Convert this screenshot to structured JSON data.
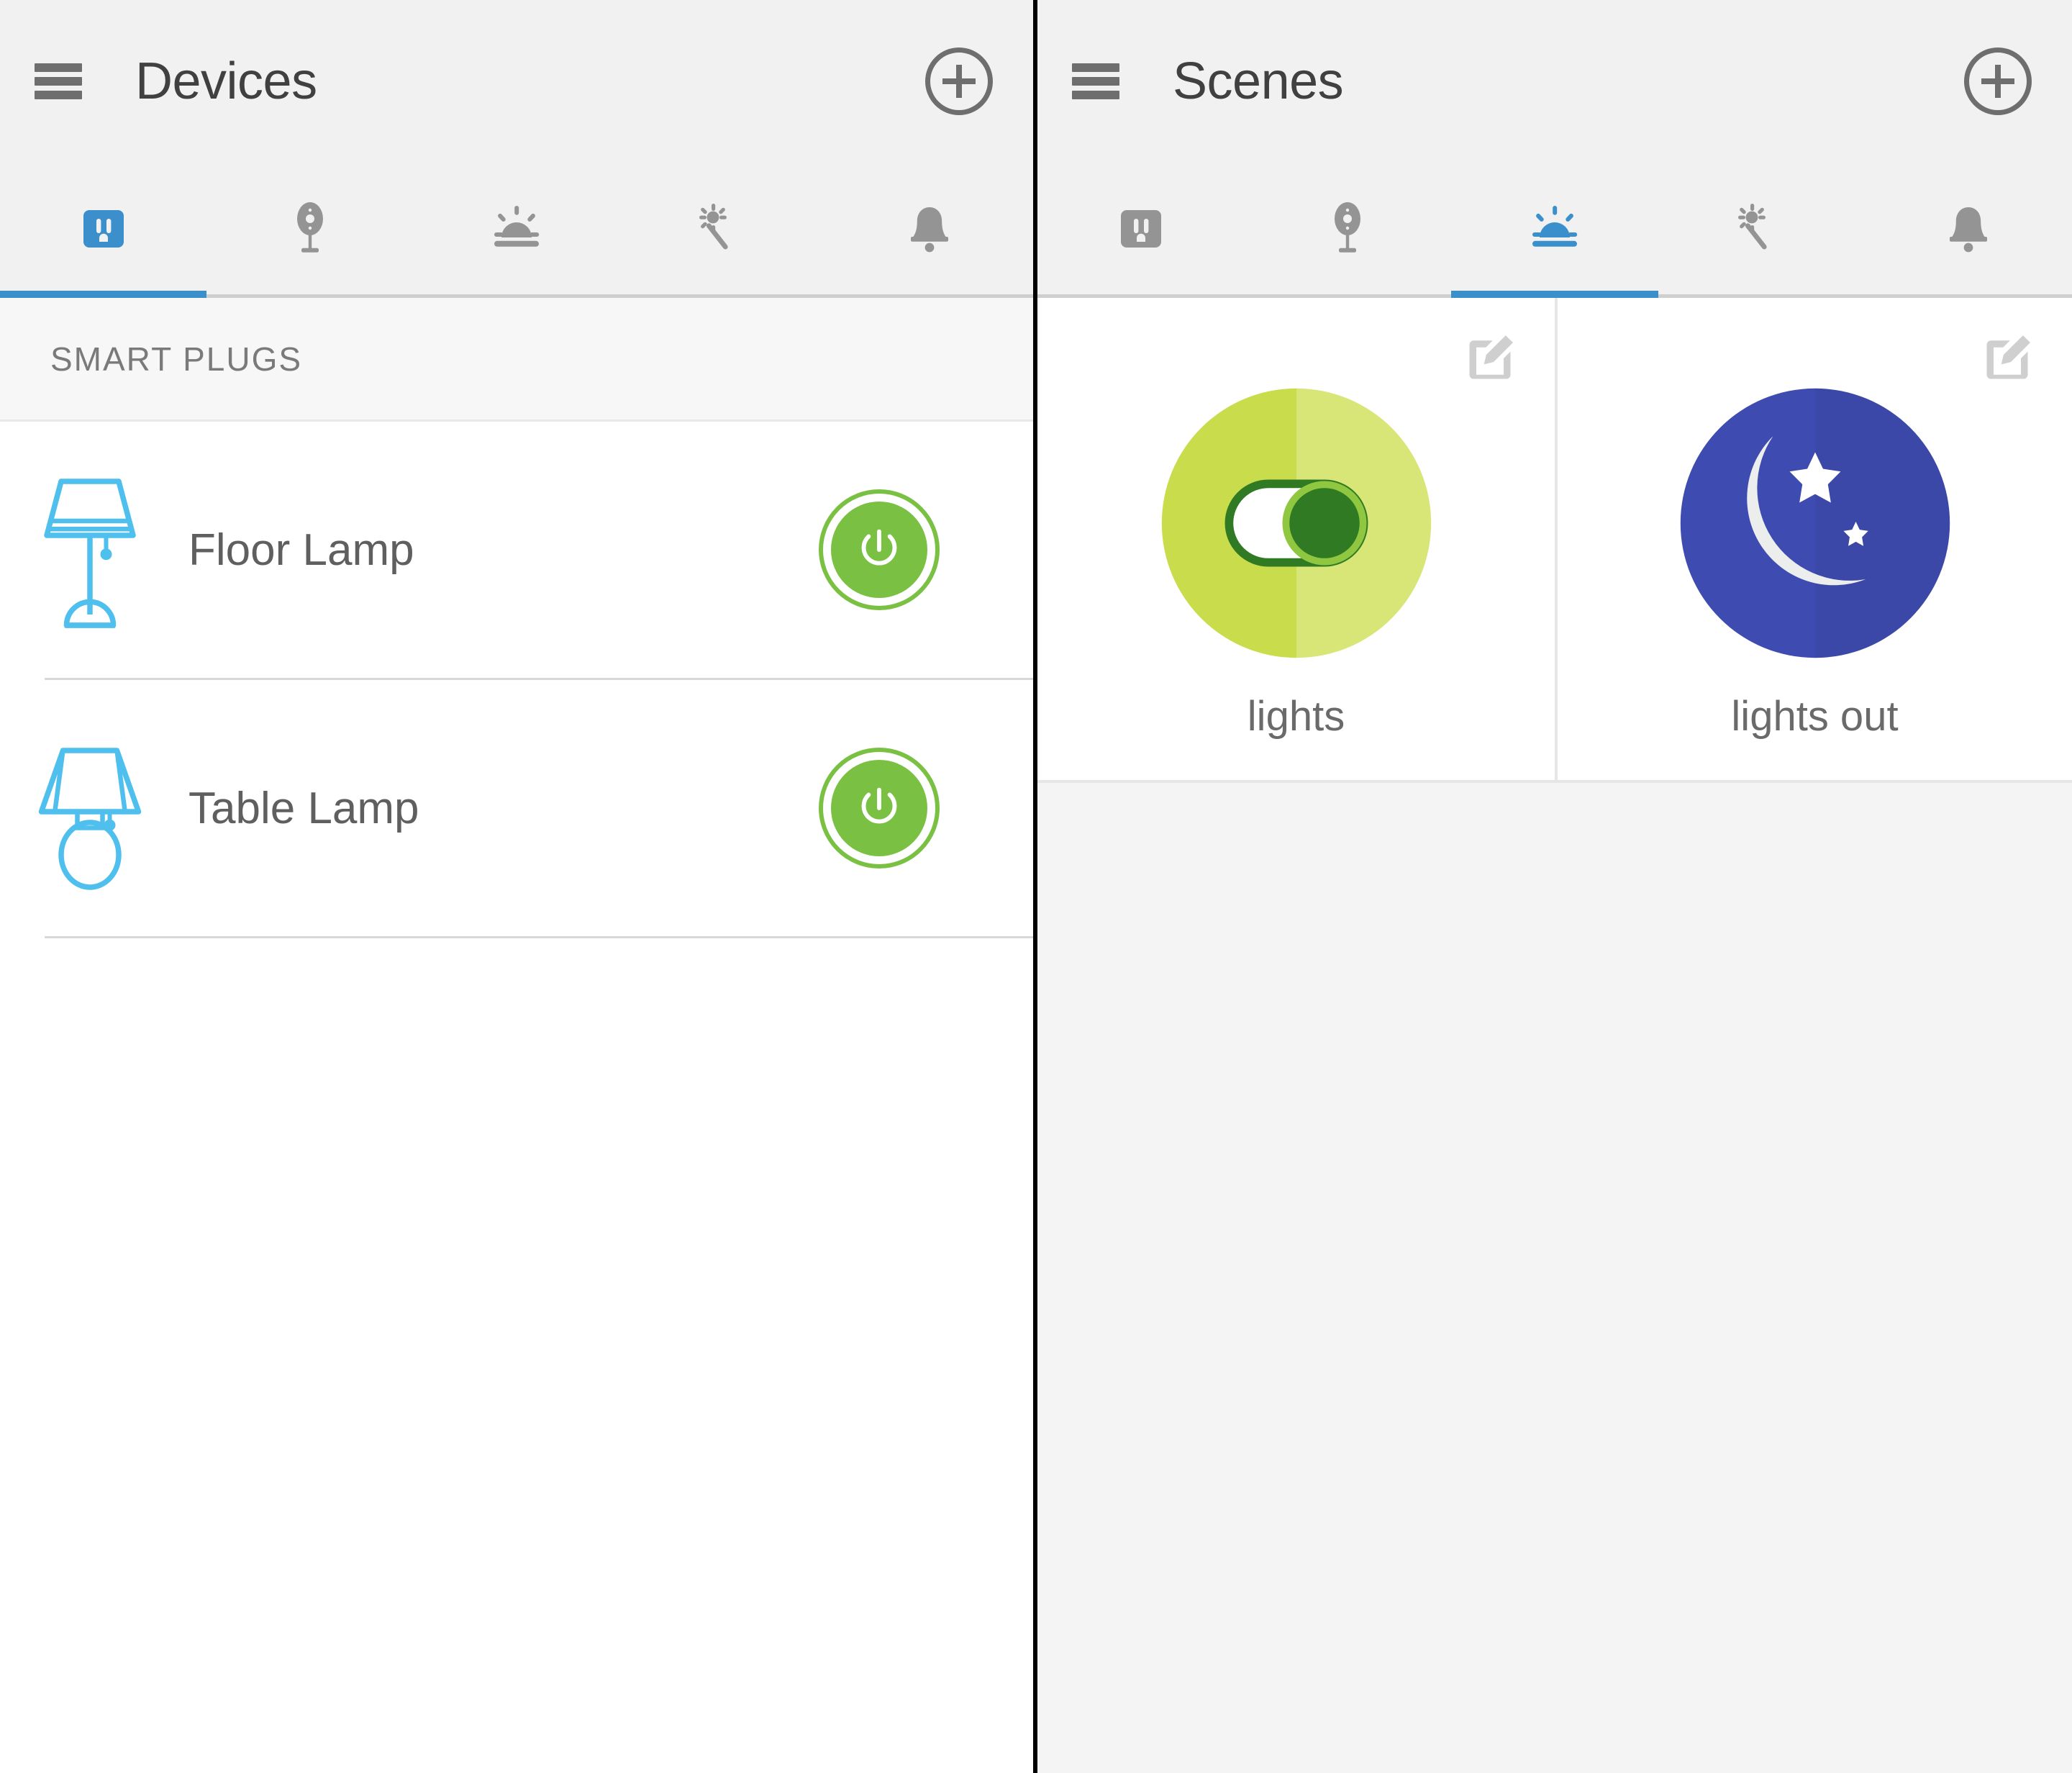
{
  "left_panel": {
    "appbar": {
      "menu_icon": "hamburger-menu-icon",
      "title": "Devices",
      "add_icon": "plus-circle-icon"
    },
    "tabs": [
      {
        "icon": "outlet-icon",
        "name": "outlets",
        "active": true
      },
      {
        "icon": "sensor-icon",
        "name": "sensors",
        "active": false
      },
      {
        "icon": "sunrise-icon",
        "name": "scenes",
        "active": false
      },
      {
        "icon": "magic-wand-icon",
        "name": "rules",
        "active": false
      },
      {
        "icon": "bell-icon",
        "name": "alerts",
        "active": false
      }
    ],
    "section_title": "SMART PLUGS",
    "devices": [
      {
        "name": "Floor Lamp",
        "icon": "floor-lamp-icon",
        "power": "on"
      },
      {
        "name": "Table Lamp",
        "icon": "table-lamp-icon",
        "power": "on"
      }
    ]
  },
  "right_panel": {
    "appbar": {
      "menu_icon": "hamburger-menu-icon",
      "title": "Scenes",
      "add_icon": "plus-circle-icon"
    },
    "tabs": [
      {
        "icon": "outlet-icon",
        "name": "outlets",
        "active": false
      },
      {
        "icon": "sensor-icon",
        "name": "sensors",
        "active": false
      },
      {
        "icon": "sunrise-icon",
        "name": "scenes",
        "active": true
      },
      {
        "icon": "magic-wand-icon",
        "name": "rules",
        "active": false
      },
      {
        "icon": "bell-icon",
        "name": "alerts",
        "active": false
      }
    ],
    "scenes": [
      {
        "label": "lights",
        "art": "toggle-on-icon",
        "edit_icon": "edit-pencil-icon"
      },
      {
        "label": "lights out",
        "art": "crescent-moon-icon",
        "edit_icon": "edit-pencil-icon"
      }
    ]
  },
  "colors": {
    "accent_blue": "#3b8fcb",
    "icon_gray": "#949494",
    "power_green": "#7ac143",
    "lamp_blue": "#4fc0ee",
    "scene_lights_light": "#d3e365",
    "scene_lights_dark": "#c9dd4c",
    "scene_lights_knob": "#2f7a22",
    "scene_night_light": "#3e4bb0",
    "scene_night_dark": "#3b48a8",
    "appbar_bg": "#f1f1f1",
    "text_dark": "#404040",
    "text_gray": "#6a6a6a"
  }
}
